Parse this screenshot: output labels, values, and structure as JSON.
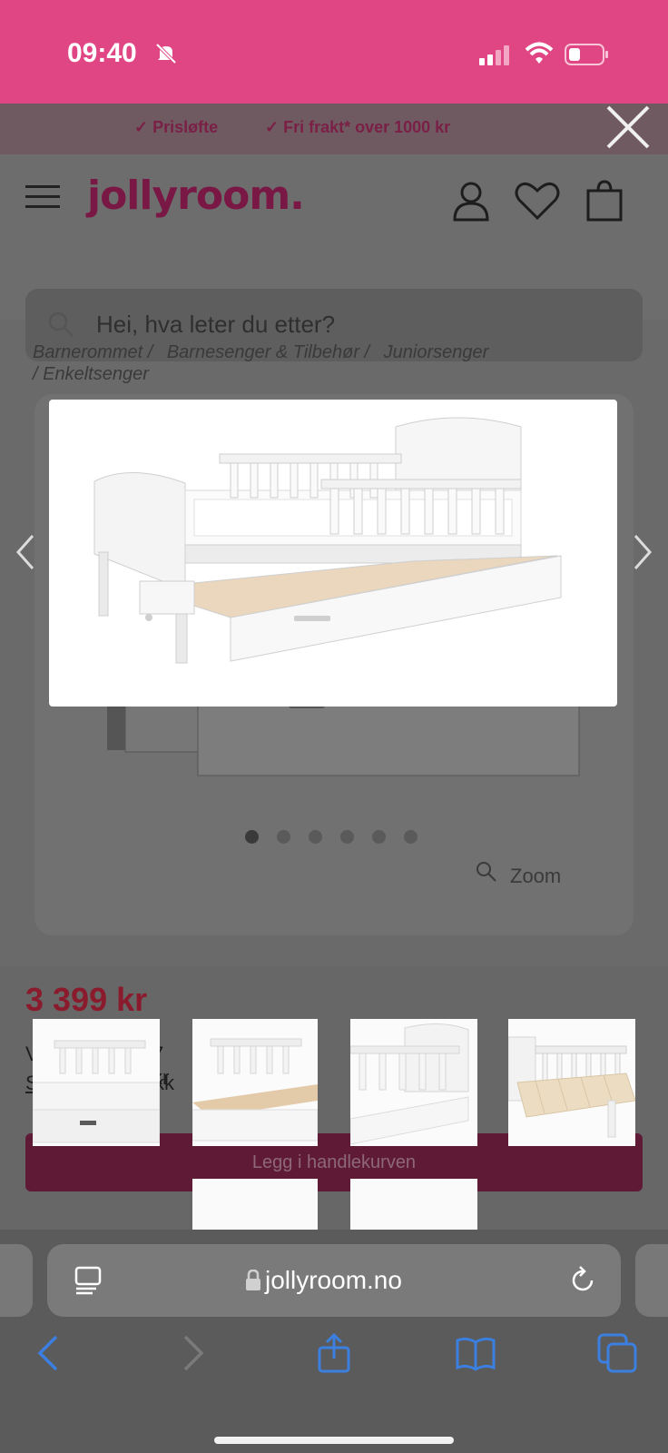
{
  "status": {
    "time": "09:40"
  },
  "promo": {
    "item1": "✓ Prisløfte",
    "item2": "✓ Fri frakt* over 1000 kr"
  },
  "header": {
    "logo": "jollyroom."
  },
  "search": {
    "placeholder": "Hei, hva leter du etter?"
  },
  "breadcrumb": [
    "Barnerommet /",
    "Barnesenger & Tilbehør /",
    "Juniorsenger",
    "/ Enkeltsenger"
  ],
  "gallery": {
    "zoom_label": "Zoom",
    "dot_count": 6,
    "active_dot": 0
  },
  "product": {
    "price": "3 399 kr",
    "monthly": "V",
    "monthly_rest": "7 kr",
    "link_start": "S",
    "link_end": "kk",
    "cart_button": "Legg i handlekurven"
  },
  "browser": {
    "url": "jollyroom.no"
  },
  "colors": {
    "brand_pink": "#e04584",
    "brand_dark": "#7a1845",
    "ios_blue": "#3b7fe0"
  },
  "icons": [
    "bell-slash-icon",
    "signal-icon",
    "wifi-icon",
    "battery-icon",
    "close-icon",
    "hamburger-icon",
    "user-icon",
    "heart-icon",
    "bag-icon",
    "search-icon",
    "chevron-left-icon",
    "chevron-right-icon",
    "reader-icon",
    "lock-icon",
    "reload-icon",
    "back-icon",
    "forward-icon",
    "share-icon",
    "bookmarks-icon",
    "tabs-icon"
  ]
}
